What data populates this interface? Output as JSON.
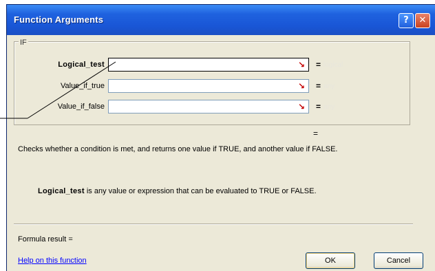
{
  "window": {
    "title": "Function Arguments",
    "help_glyph": "?",
    "close_glyph": "✕"
  },
  "group": {
    "label": "IF"
  },
  "args": [
    {
      "label": "Logical_test",
      "value": "",
      "type_hint": "logical"
    },
    {
      "label": "Value_if_true",
      "value": "",
      "type_hint": "any"
    },
    {
      "label": "Value_if_false",
      "value": "",
      "type_hint": "any"
    }
  ],
  "equals": "=",
  "description": "Checks whether a condition is met, and returns one value if TRUE, and another value if FALSE.",
  "arg_description": {
    "name": "Logical_test",
    "text": " is any value or expression that can be evaluated to TRUE or FALSE."
  },
  "formula_result_label": "Formula result =",
  "help_link": "Help on this function",
  "buttons": {
    "ok": "OK",
    "cancel": "Cancel"
  },
  "icons": {
    "ref_icon": "collapse-dialog-icon"
  }
}
